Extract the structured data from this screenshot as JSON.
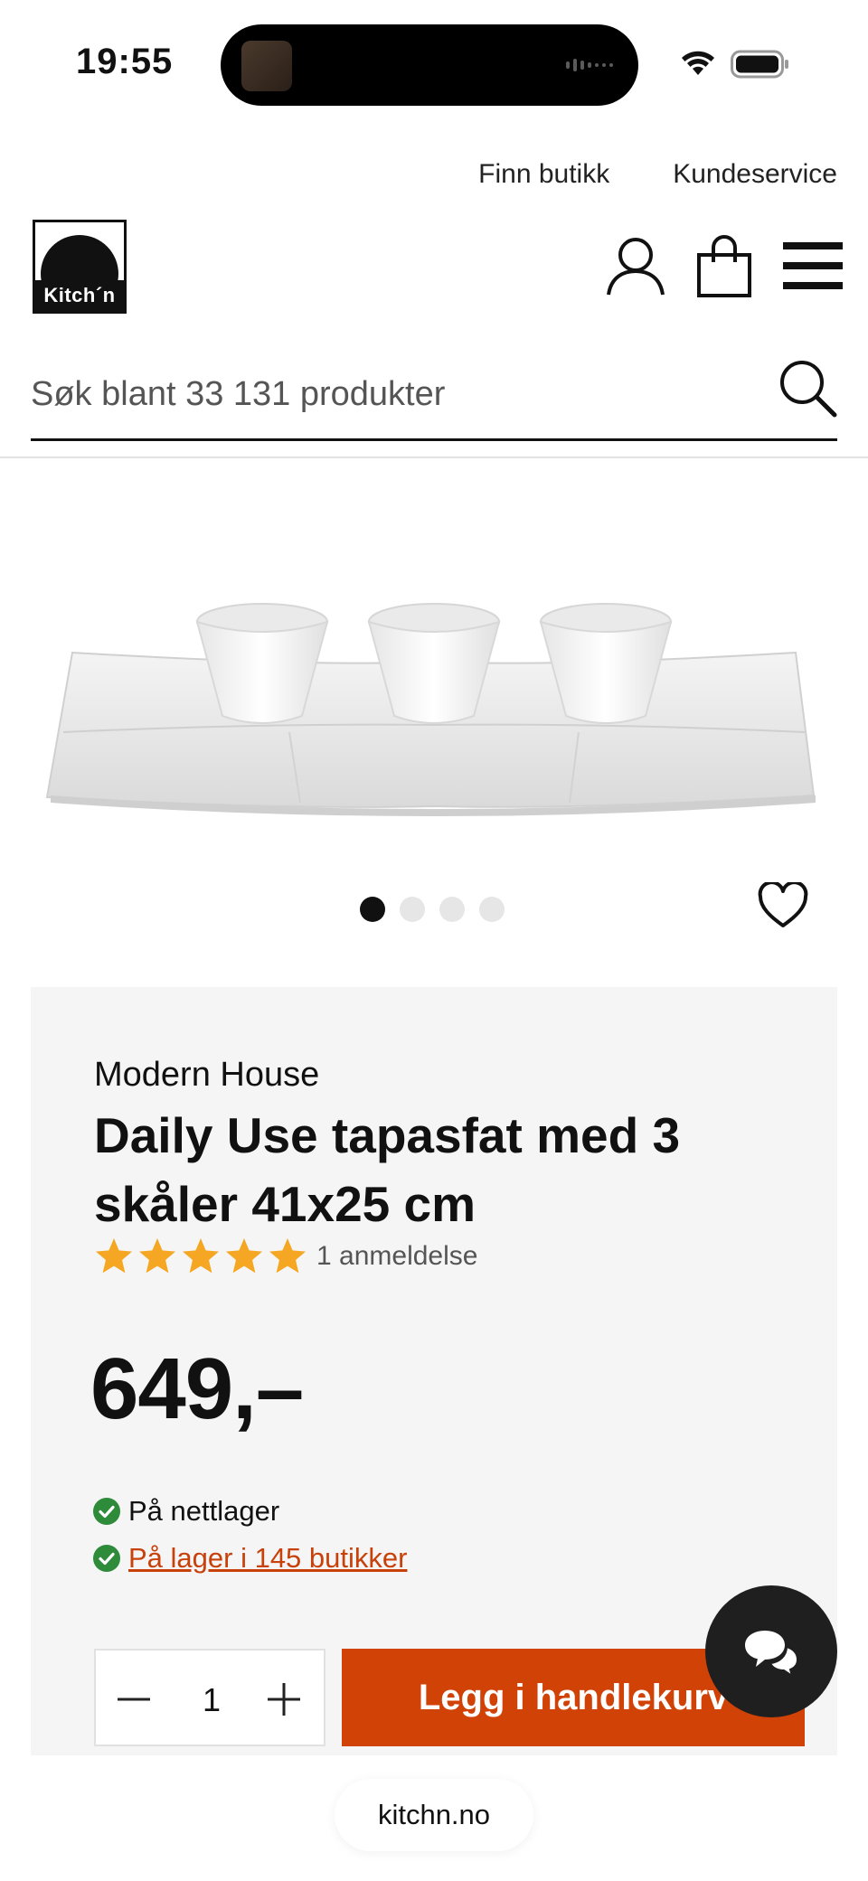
{
  "status_bar": {
    "time": "19:55"
  },
  "top_links": {
    "find_store": "Finn butikk",
    "customer_service": "Kundeservice"
  },
  "header": {
    "logo_text": "Kitch´n"
  },
  "search": {
    "placeholder": "Søk blant 33 131 produkter"
  },
  "gallery": {
    "image_count": 4,
    "active_index": 0
  },
  "product": {
    "brand": "Modern House",
    "title": "Daily Use tapasfat med 3 skåler 41x25 cm",
    "rating": 5,
    "rating_max": 5,
    "review_count_label": "1 anmeldelse",
    "price": "649,–",
    "stock_online": "På nettlager",
    "stock_stores": "På lager i 145 butikker"
  },
  "purchase": {
    "quantity": "1",
    "add_to_cart_label": "Legg i handlekurv"
  },
  "browser": {
    "url": "kitchn.no"
  },
  "colors": {
    "accent": "#d14207",
    "stock_ok": "#2e8b3a",
    "star": "#f5a623",
    "panel_bg": "#f5f5f5"
  }
}
